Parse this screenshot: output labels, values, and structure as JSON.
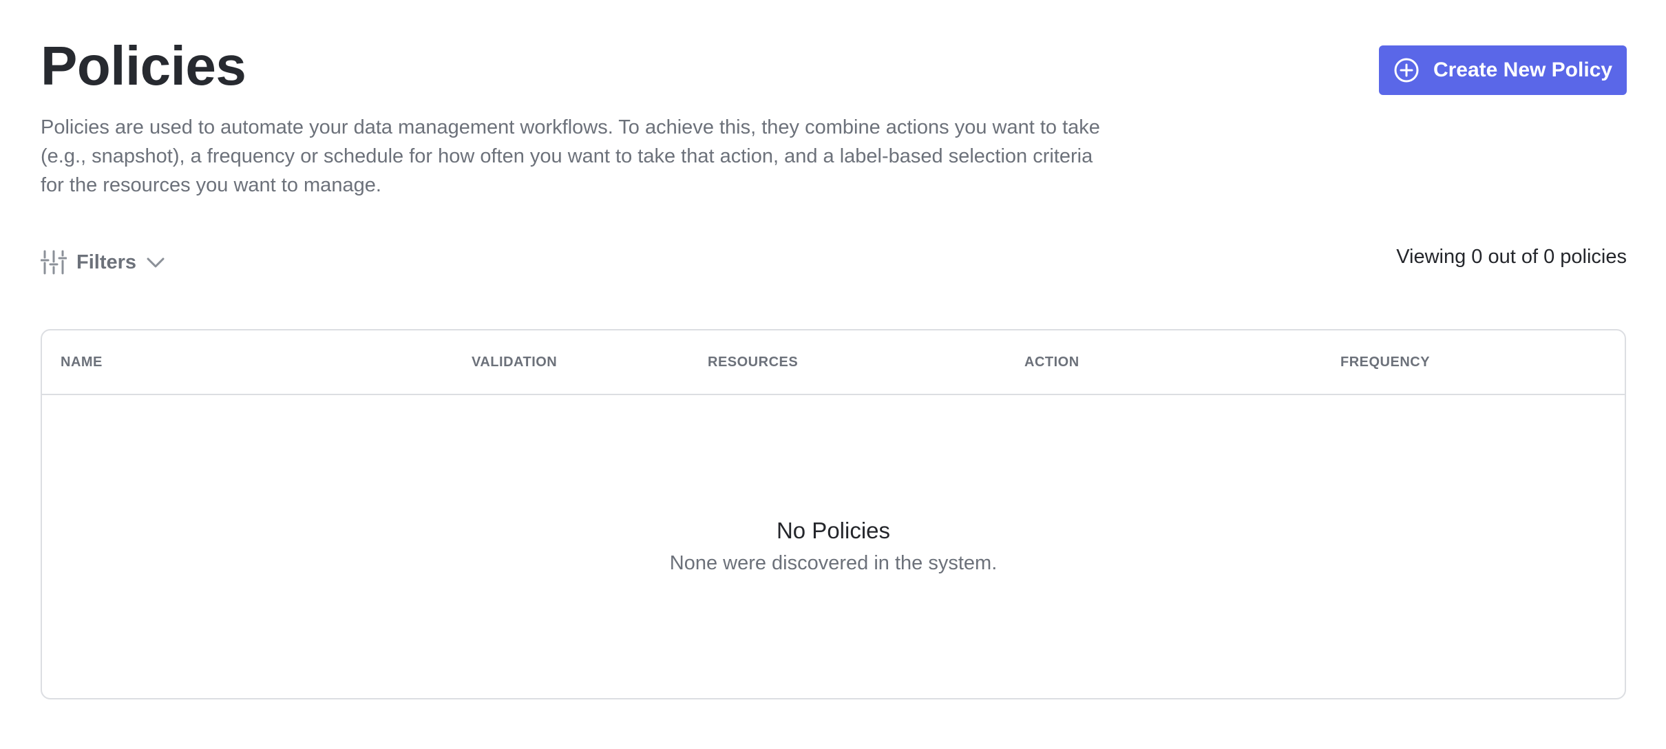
{
  "header": {
    "title": "Policies",
    "description": "Policies are used to automate your data management workflows. To achieve this, they combine actions you want to take (e.g., snapshot), a frequency or schedule for how often you want to take that action, and a label-based selection criteria for the resources you want to manage.",
    "create_button": {
      "label": "Create New Policy",
      "icon": "plus-circle-icon"
    }
  },
  "toolbar": {
    "filters_label": "Filters",
    "filters_icon": "sliders-icon",
    "filters_chevron_icon": "chevron-down-icon",
    "viewing_text": "Viewing 0 out of 0 policies"
  },
  "table": {
    "columns": [
      "NAME",
      "VALIDATION",
      "RESOURCES",
      "ACTION",
      "FREQUENCY"
    ],
    "rows": [],
    "empty_title": "No Policies",
    "empty_subtitle": "None were discovered in the system."
  },
  "colors": {
    "accent": "#5a67e8",
    "text_primary": "#24262b",
    "text_muted": "#6c717a",
    "border": "#dcdee2"
  }
}
